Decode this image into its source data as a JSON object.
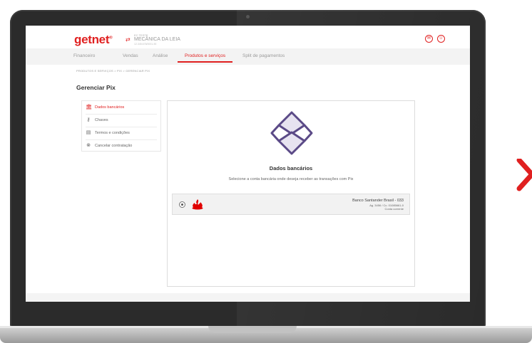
{
  "header": {
    "logo": "getnet",
    "logo_reg": "®",
    "store_label": "EC TESTE",
    "store_name": "MECÂNICA DA LEIA",
    "store_sub": "12.345.678/0001-90"
  },
  "nav": {
    "items": [
      {
        "label": "Financeiro"
      },
      {
        "label": "Vendas"
      },
      {
        "label": "Análise"
      },
      {
        "label": "Produtos e serviços"
      },
      {
        "label": "Split de pagamentos"
      }
    ],
    "active_index": 3
  },
  "breadcrumb": "PRODUTOS E SERVIÇOS  >  PIX  >  GERENCIAR PIX",
  "page_title": "Gerenciar Pix",
  "menu": {
    "items": [
      {
        "label": "Dados bancários",
        "icon": "bank-icon"
      },
      {
        "label": "Chaves",
        "icon": "key-icon"
      },
      {
        "label": "Termos e condições",
        "icon": "document-icon"
      },
      {
        "label": "Cancelar contratação",
        "icon": "cancel-icon"
      }
    ],
    "active_index": 0
  },
  "content": {
    "title": "Dados bancários",
    "description": "Selecione a conta bancária onde deseja receber as transações com Pix"
  },
  "account": {
    "bank_name": "Banco Santander Brasil - 033",
    "details": "Ag. 3456 / Cc. 01085661-0",
    "type": "Conta corrente"
  },
  "colors": {
    "brand": "#e02020",
    "pix": "#5b4a87"
  }
}
